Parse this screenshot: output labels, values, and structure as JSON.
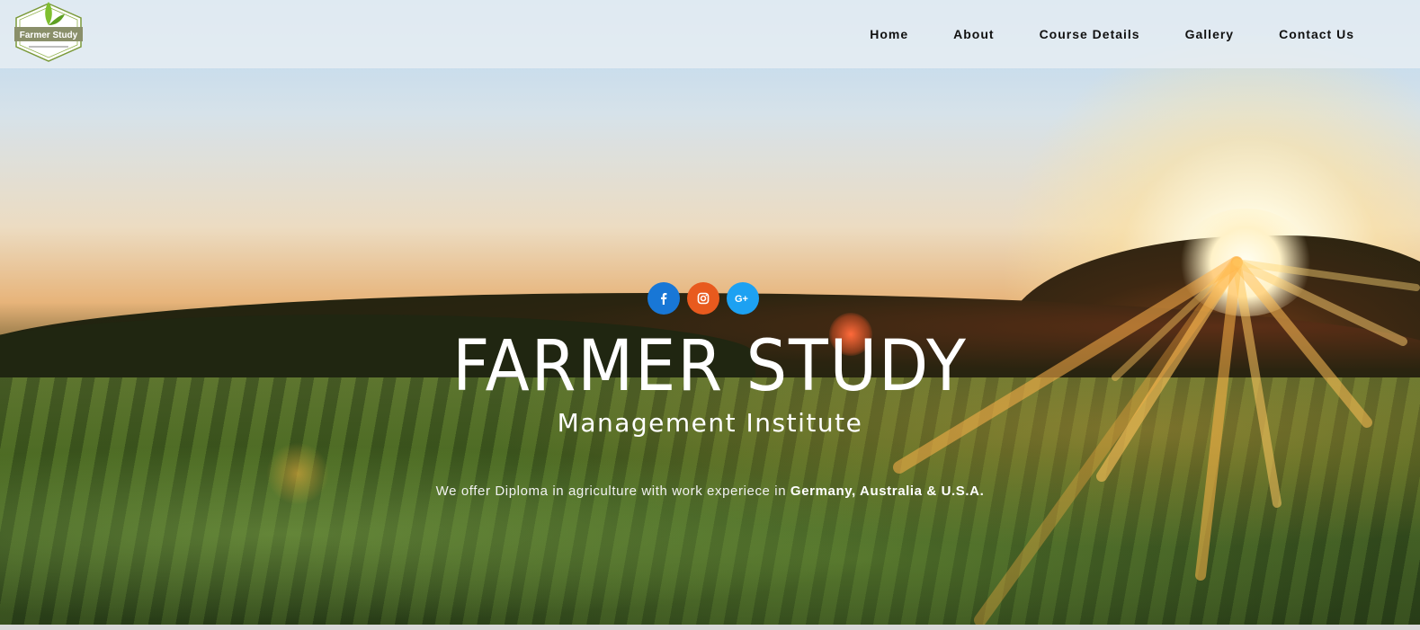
{
  "header": {
    "logo_text": "Farmer Study",
    "nav": [
      {
        "label": "Home"
      },
      {
        "label": "About"
      },
      {
        "label": "Course Details"
      },
      {
        "label": "Gallery"
      },
      {
        "label": "Contact Us"
      }
    ]
  },
  "hero": {
    "social_icons": [
      {
        "name": "facebook-icon",
        "color": "#1877d6"
      },
      {
        "name": "instagram-icon",
        "color": "#e85a1e"
      },
      {
        "name": "google-plus-icon",
        "color": "#1da1f2"
      }
    ],
    "title": "FARMER STUDY",
    "subtitle": "Management Institute",
    "tagline_prefix": "We offer Diploma in agriculture with work experiece in ",
    "tagline_bold": "Germany, Australia & U.S.A."
  }
}
